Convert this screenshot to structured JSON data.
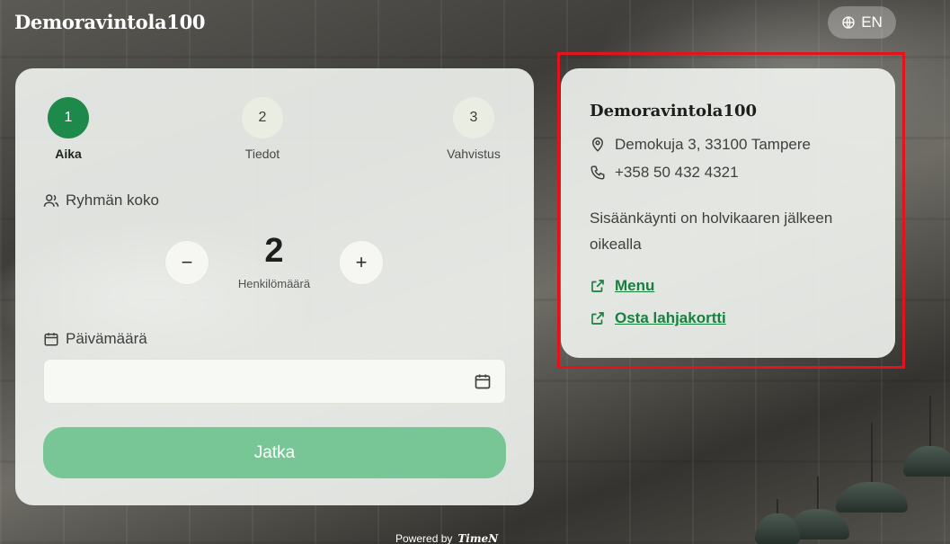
{
  "brand": {
    "name": "Demoravintola100"
  },
  "language": {
    "label": "EN",
    "icon": "globe-icon"
  },
  "booking": {
    "steps": [
      {
        "number": "1",
        "label": "Aika",
        "active": true
      },
      {
        "number": "2",
        "label": "Tiedot",
        "active": false
      },
      {
        "number": "3",
        "label": "Vahvistus",
        "active": false
      }
    ],
    "group_size": {
      "label": "Ryhmän koko",
      "icon": "users-icon",
      "value": "2",
      "sublabel": "Henkilömäärä",
      "decrement": "−",
      "increment": "+"
    },
    "date": {
      "label": "Päivämäärä",
      "icon": "calendar-icon",
      "value": "",
      "placeholder": ""
    },
    "continue_label": "Jatka"
  },
  "info": {
    "title": "Demoravintola100",
    "address": "Demokuja 3, 33100 Tampere",
    "phone": "+358 50 432 4321",
    "note": "Sisäänkäynti on holvikaaren jälkeen oikealla",
    "links": [
      {
        "label": "Menu",
        "icon": "external-link-icon"
      },
      {
        "label": "Osta lahjakortti",
        "icon": "external-link-icon"
      }
    ]
  },
  "footer": {
    "powered_by": "Powered by",
    "logo_text": "TimeN"
  },
  "colors": {
    "accent": "#1d8a4c",
    "button": "#78c596",
    "link": "#17803f",
    "highlight": "#e4121a"
  }
}
